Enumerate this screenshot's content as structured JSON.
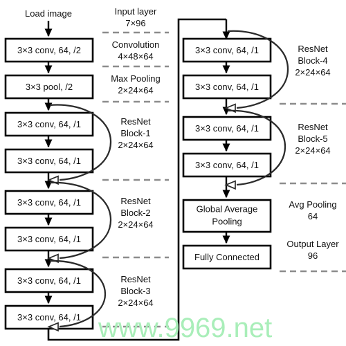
{
  "diagram": {
    "title": "ResNet CNN architecture flowchart",
    "watermark": "www.9969.net",
    "colors": {
      "box_stroke": "#000000",
      "box_fill": "#ffffff",
      "arrow": "#000000",
      "skip_arrow": "#2b2b2b",
      "separator": "#8c8c8c",
      "watermark": "#a9eeb9"
    },
    "entry_caption": "Load image",
    "left_column": {
      "boxes": [
        {
          "id": "conv1",
          "label": "3×3 conv, 64, /2"
        },
        {
          "id": "pool1",
          "label": "3×3 pool, /2"
        },
        {
          "id": "b1-conv1",
          "label": "3×3 conv, 64, /1"
        },
        {
          "id": "b1-conv2",
          "label": "3×3 conv, 64, /1"
        },
        {
          "id": "b2-conv1",
          "label": "3×3 conv, 64, /1"
        },
        {
          "id": "b2-conv2",
          "label": "3×3 conv, 64, /1"
        },
        {
          "id": "b3-conv1",
          "label": "3×3 conv, 64, /1"
        },
        {
          "id": "b3-conv2",
          "label": "3×3 conv, 64, /1"
        }
      ]
    },
    "right_column": {
      "boxes": [
        {
          "id": "b4-conv1",
          "label": "3×3 conv, 64, /1"
        },
        {
          "id": "b4-conv2",
          "label": "3×3 conv, 64, /1"
        },
        {
          "id": "b5-conv1",
          "label": "3×3 conv, 64, /1"
        },
        {
          "id": "b5-conv2",
          "label": "3×3 conv, 64, /1"
        },
        {
          "id": "gap",
          "label_line1": "Global Average",
          "label_line2": "Pooling"
        },
        {
          "id": "fc",
          "label": "Fully Connected"
        }
      ]
    },
    "left_annotations": [
      {
        "id": "input-layer",
        "line1": "Input layer",
        "line2": "7×96",
        "line3": ""
      },
      {
        "id": "convolution",
        "line1": "Convolution",
        "line2": "4×48×64",
        "line3": ""
      },
      {
        "id": "max-pooling",
        "line1": "Max Pooling",
        "line2": "2×24×64",
        "line3": ""
      },
      {
        "id": "resnet-block-1",
        "line1": "ResNet",
        "line2": "Block-1",
        "line3": "2×24×64"
      },
      {
        "id": "resnet-block-2",
        "line1": "ResNet",
        "line2": "Block-2",
        "line3": "2×24×64"
      },
      {
        "id": "resnet-block-3",
        "line1": "ResNet",
        "line2": "Block-3",
        "line3": "2×24×64"
      }
    ],
    "right_annotations": [
      {
        "id": "resnet-block-4",
        "line1": "ResNet",
        "line2": "Block-4",
        "line3": "2×24×64"
      },
      {
        "id": "resnet-block-5",
        "line1": "ResNet",
        "line2": "Block-5",
        "line3": "2×24×64"
      },
      {
        "id": "avg-pooling",
        "line1": "Avg Pooling",
        "line2": "64",
        "line3": ""
      },
      {
        "id": "output-layer",
        "line1": "Output Layer",
        "line2": "96",
        "line3": ""
      }
    ]
  }
}
